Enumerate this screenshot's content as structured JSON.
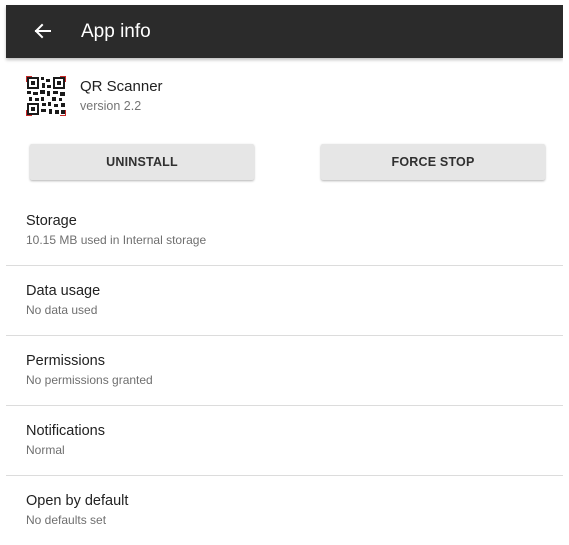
{
  "appbar": {
    "back_icon": "arrow-back-icon",
    "title": "App info"
  },
  "app": {
    "icon": "qr-code-icon",
    "name": "QR Scanner",
    "version": "version 2.2"
  },
  "actions": {
    "uninstall_label": "UNINSTALL",
    "force_stop_label": "FORCE STOP"
  },
  "settings": {
    "items": [
      {
        "title": "Storage",
        "subtitle": "10.15 MB used in Internal storage"
      },
      {
        "title": "Data usage",
        "subtitle": "No data used"
      },
      {
        "title": "Permissions",
        "subtitle": "No permissions granted"
      },
      {
        "title": "Notifications",
        "subtitle": "Normal"
      },
      {
        "title": "Open by default",
        "subtitle": "No defaults set"
      }
    ]
  },
  "colors": {
    "appbar_bg": "#2b2b2b",
    "button_bg": "#e6e6e6",
    "divider": "#dcdcdc",
    "qr_accent": "#c62828"
  }
}
